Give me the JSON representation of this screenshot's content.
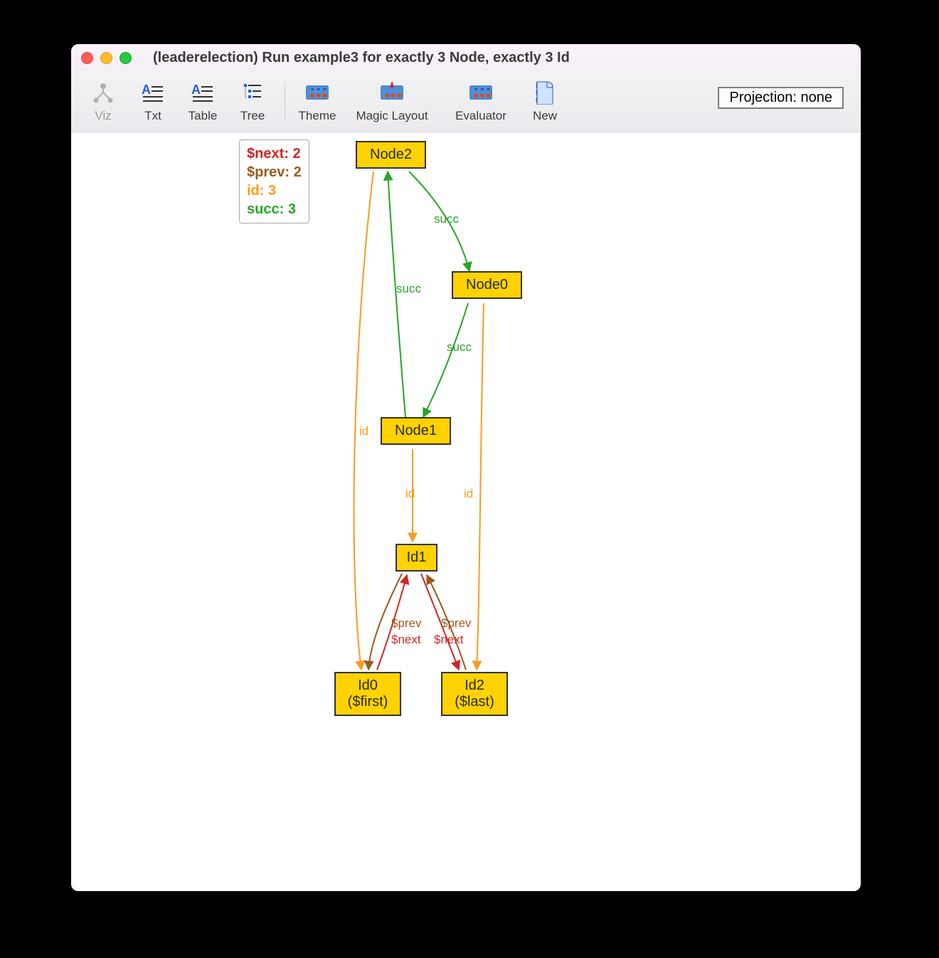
{
  "window": {
    "title": "(leaderelection) Run example3 for exactly 3 Node, exactly 3 Id"
  },
  "toolbar": {
    "viz": "Viz",
    "txt": "Txt",
    "table": "Table",
    "tree": "Tree",
    "theme": "Theme",
    "magiclayout": "Magic Layout",
    "evaluator": "Evaluator",
    "new": "New",
    "projection": "Projection: none"
  },
  "legend": {
    "next_key": "$next:",
    "next_val": "2",
    "prev_key": "$prev:",
    "prev_val": "2",
    "id_key": "id:",
    "id_val": "3",
    "succ_key": "succ:",
    "succ_val": "3"
  },
  "colors": {
    "next": "#d22424",
    "prev": "#9b5a1f",
    "id": "#ff9a1a",
    "succ": "#28a428"
  },
  "graph": {
    "nodes": {
      "Node2": {
        "label": "Node2"
      },
      "Node0": {
        "label": "Node0"
      },
      "Node1": {
        "label": "Node1"
      },
      "Id1": {
        "label": "Id1"
      },
      "Id0": {
        "label1": "Id0",
        "label2": "($first)"
      },
      "Id2": {
        "label1": "Id2",
        "label2": "($last)"
      }
    },
    "edge_labels": {
      "succ": "succ",
      "id": "id",
      "prev": "$prev",
      "next": "$next"
    }
  }
}
